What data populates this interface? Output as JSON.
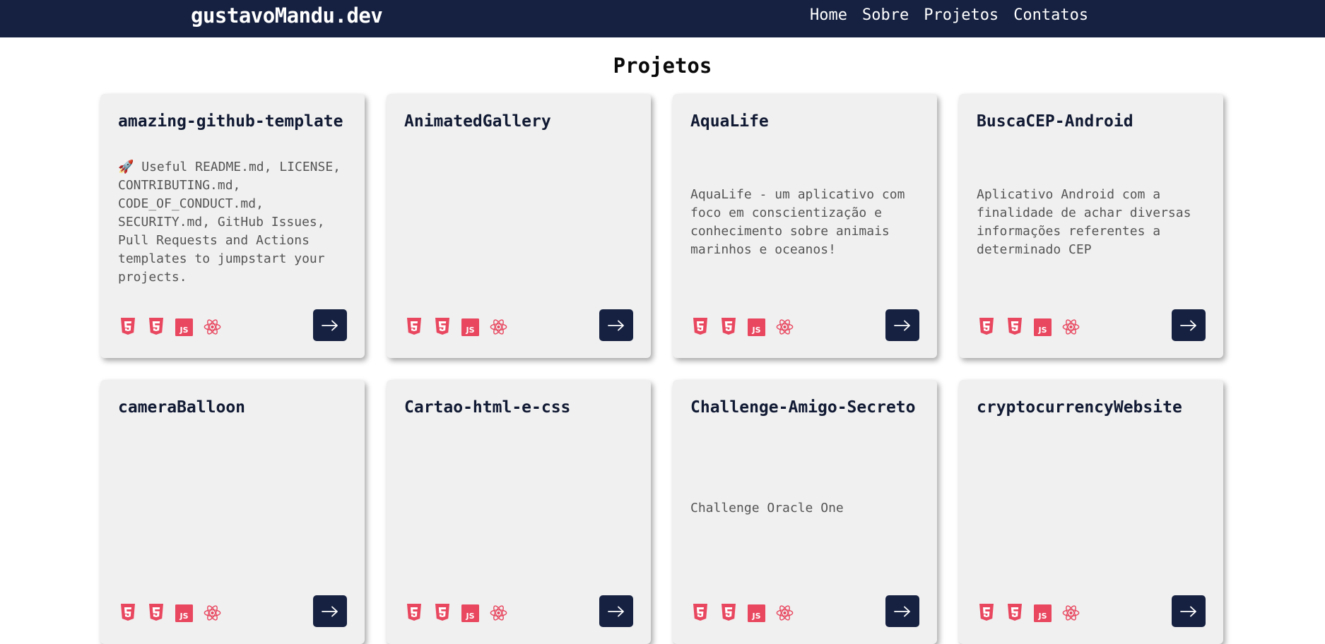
{
  "header": {
    "brand": "gustavoMandu.dev",
    "nav": [
      "Home",
      "Sobre",
      "Projetos",
      "Contatos"
    ]
  },
  "section": {
    "title": "Projetos"
  },
  "colors": {
    "navy": "#162141",
    "icon_red": "#e8475f",
    "card_bg": "#f0f0f0"
  },
  "tech_icons": [
    "html5-icon",
    "css3-icon",
    "javascript-icon",
    "react-icon"
  ],
  "projects": [
    {
      "title": "amazing-github-template",
      "description": "🚀 Useful README.md, LICENSE, CONTRIBUTING.md, CODE_OF_CONDUCT.md, SECURITY.md, GitHub Issues, Pull Requests and Actions templates to jumpstart your projects."
    },
    {
      "title": "AnimatedGallery",
      "description": ""
    },
    {
      "title": "AquaLife",
      "description": "AquaLife - um aplicativo com foco em conscientização e conhecimento sobre animais marinhos e oceanos!"
    },
    {
      "title": "BuscaCEP-Android",
      "description": "Aplicativo Android com a finalidade de achar diversas informações referentes a determinado CEP"
    },
    {
      "title": "cameraBalloon",
      "description": ""
    },
    {
      "title": "Cartao-html-e-css",
      "description": ""
    },
    {
      "title": "Challenge-Amigo-Secreto",
      "description": "Challenge Oracle One"
    },
    {
      "title": "cryptocurrencyWebsite",
      "description": ""
    }
  ]
}
